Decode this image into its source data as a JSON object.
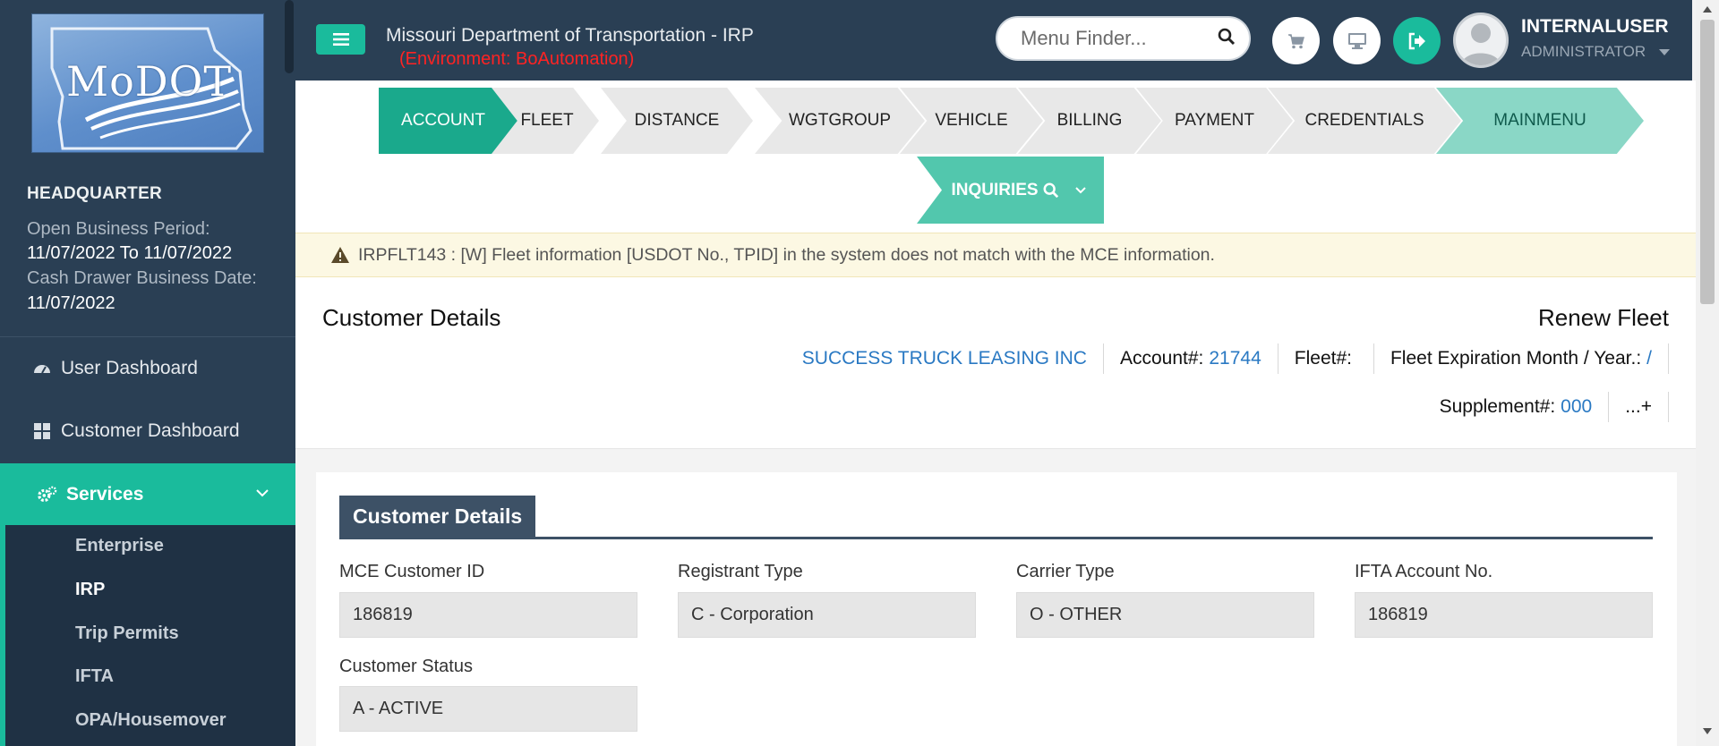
{
  "app": {
    "title": "Missouri Department of Transportation - IRP",
    "environment": "(Environment: BoAutomation)"
  },
  "sidebar": {
    "logo_text": "MoDOT",
    "office": "HEADQUARTER",
    "open_period_label": "Open Business Period:",
    "open_period_value": "11/07/2022 To 11/07/2022",
    "cash_drawer_label": "Cash Drawer Business Date:",
    "cash_drawer_value": "11/07/2022",
    "nav": [
      {
        "label": "User Dashboard",
        "icon": "dashboard-gauge-icon"
      },
      {
        "label": "Customer Dashboard",
        "icon": "grid-icon"
      },
      {
        "label": "Services",
        "icon": "gears-icon",
        "active": true
      }
    ],
    "sub_items": [
      "Enterprise",
      "IRP",
      "Trip Permits",
      "IFTA",
      "OPA/Housemover"
    ],
    "active_sub": "IRP"
  },
  "header": {
    "search_placeholder": "Menu Finder...",
    "user_name": "INTERNALUSER",
    "user_role": "ADMINISTRATOR",
    "accent": "#1abb9c",
    "navy": "#2a3f54"
  },
  "steps": {
    "items": [
      "ACCOUNT",
      "FLEET",
      "DISTANCE",
      "WGTGROUP",
      "VEHICLE",
      "BILLING",
      "PAYMENT",
      "CREDENTIALS",
      "MAINMENU"
    ],
    "active": "ACCOUNT",
    "inquiries_label": "INQUIRIES"
  },
  "alert": {
    "text": "IRPFLT143 : [W] Fleet information [USDOT No., TPID] in the system does not match with the MCE information."
  },
  "customer_header": {
    "title": "Customer Details",
    "action_title": "Renew Fleet",
    "company": "SUCCESS TRUCK LEASING INC",
    "account_label": "Account#:",
    "account_value": "21744",
    "fleet_label": "Fleet#:",
    "fleet_value": "",
    "expiration_label": "Fleet Expiration Month / Year.:",
    "expiration_value": "/",
    "supplement_label": "Supplement#:",
    "supplement_value": "000",
    "more_label": "...+"
  },
  "customer_panel": {
    "tab_title": "Customer Details",
    "fields": [
      {
        "label": "MCE Customer ID",
        "value": "186819"
      },
      {
        "label": "Registrant Type",
        "value": "C - Corporation"
      },
      {
        "label": "Carrier Type",
        "value": "O - OTHER"
      },
      {
        "label": "IFTA Account No.",
        "value": "186819"
      },
      {
        "label": "Customer Status",
        "value": "A - ACTIVE"
      }
    ]
  }
}
